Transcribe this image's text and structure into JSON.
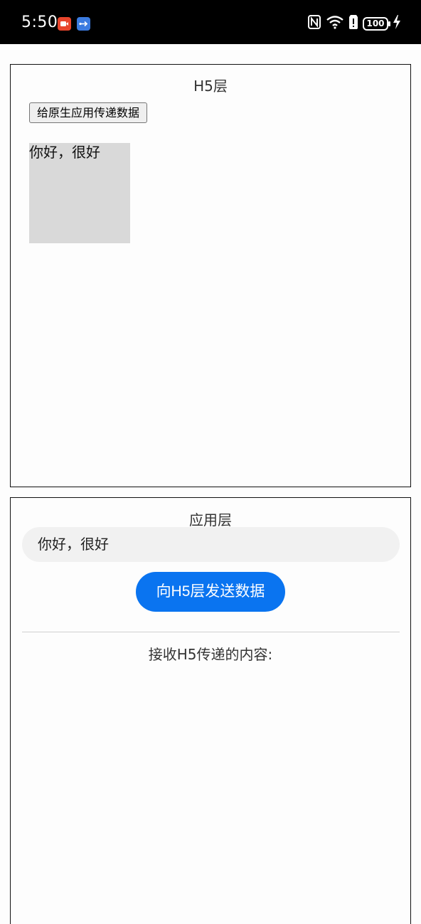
{
  "status_bar": {
    "time": "5:50",
    "battery": "100",
    "icons": [
      "record-icon",
      "usb-icon",
      "nfc-icon",
      "wifi-icon",
      "alert-icon",
      "battery-icon",
      "charging-icon"
    ]
  },
  "h5_panel": {
    "title": "H5层",
    "button_label": "给原生应用传递数据",
    "message": "你好，很好"
  },
  "app_panel": {
    "title": "应用层",
    "input_value": "你好，很好",
    "send_button_label": "向H5层发送数据",
    "receive_label": "接收H5传递的内容:"
  },
  "colors": {
    "accent": "#0a74f0",
    "status_bar_bg": "#000000",
    "box_bg": "#d9d9d9"
  }
}
